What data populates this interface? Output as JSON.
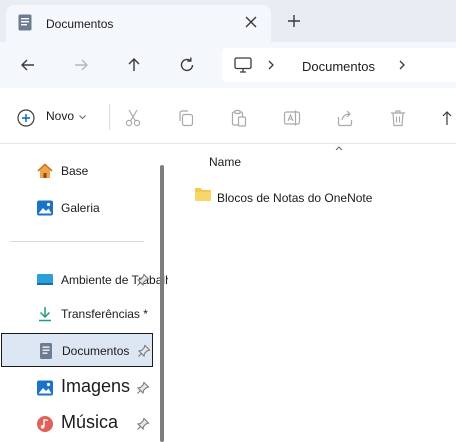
{
  "tab": {
    "title": "Documentos"
  },
  "address": {
    "segment": "Documentos"
  },
  "command_bar": {
    "new_label": "Novo"
  },
  "content": {
    "column_name": "Name",
    "items": [
      {
        "name": "Blocos de Notas do OneNote"
      }
    ]
  },
  "sidebar": {
    "items": [
      {
        "label": "Base"
      },
      {
        "label": "Galeria"
      },
      {
        "label": "Ambiente de Trabalho"
      },
      {
        "label": "Transferências *"
      },
      {
        "label": "Documentos"
      },
      {
        "label": "Imagens"
      },
      {
        "label": "Música"
      }
    ]
  },
  "colors": {
    "accent": "#0067c0",
    "selection": "#dde7f3",
    "folder": "#f3c94b"
  }
}
